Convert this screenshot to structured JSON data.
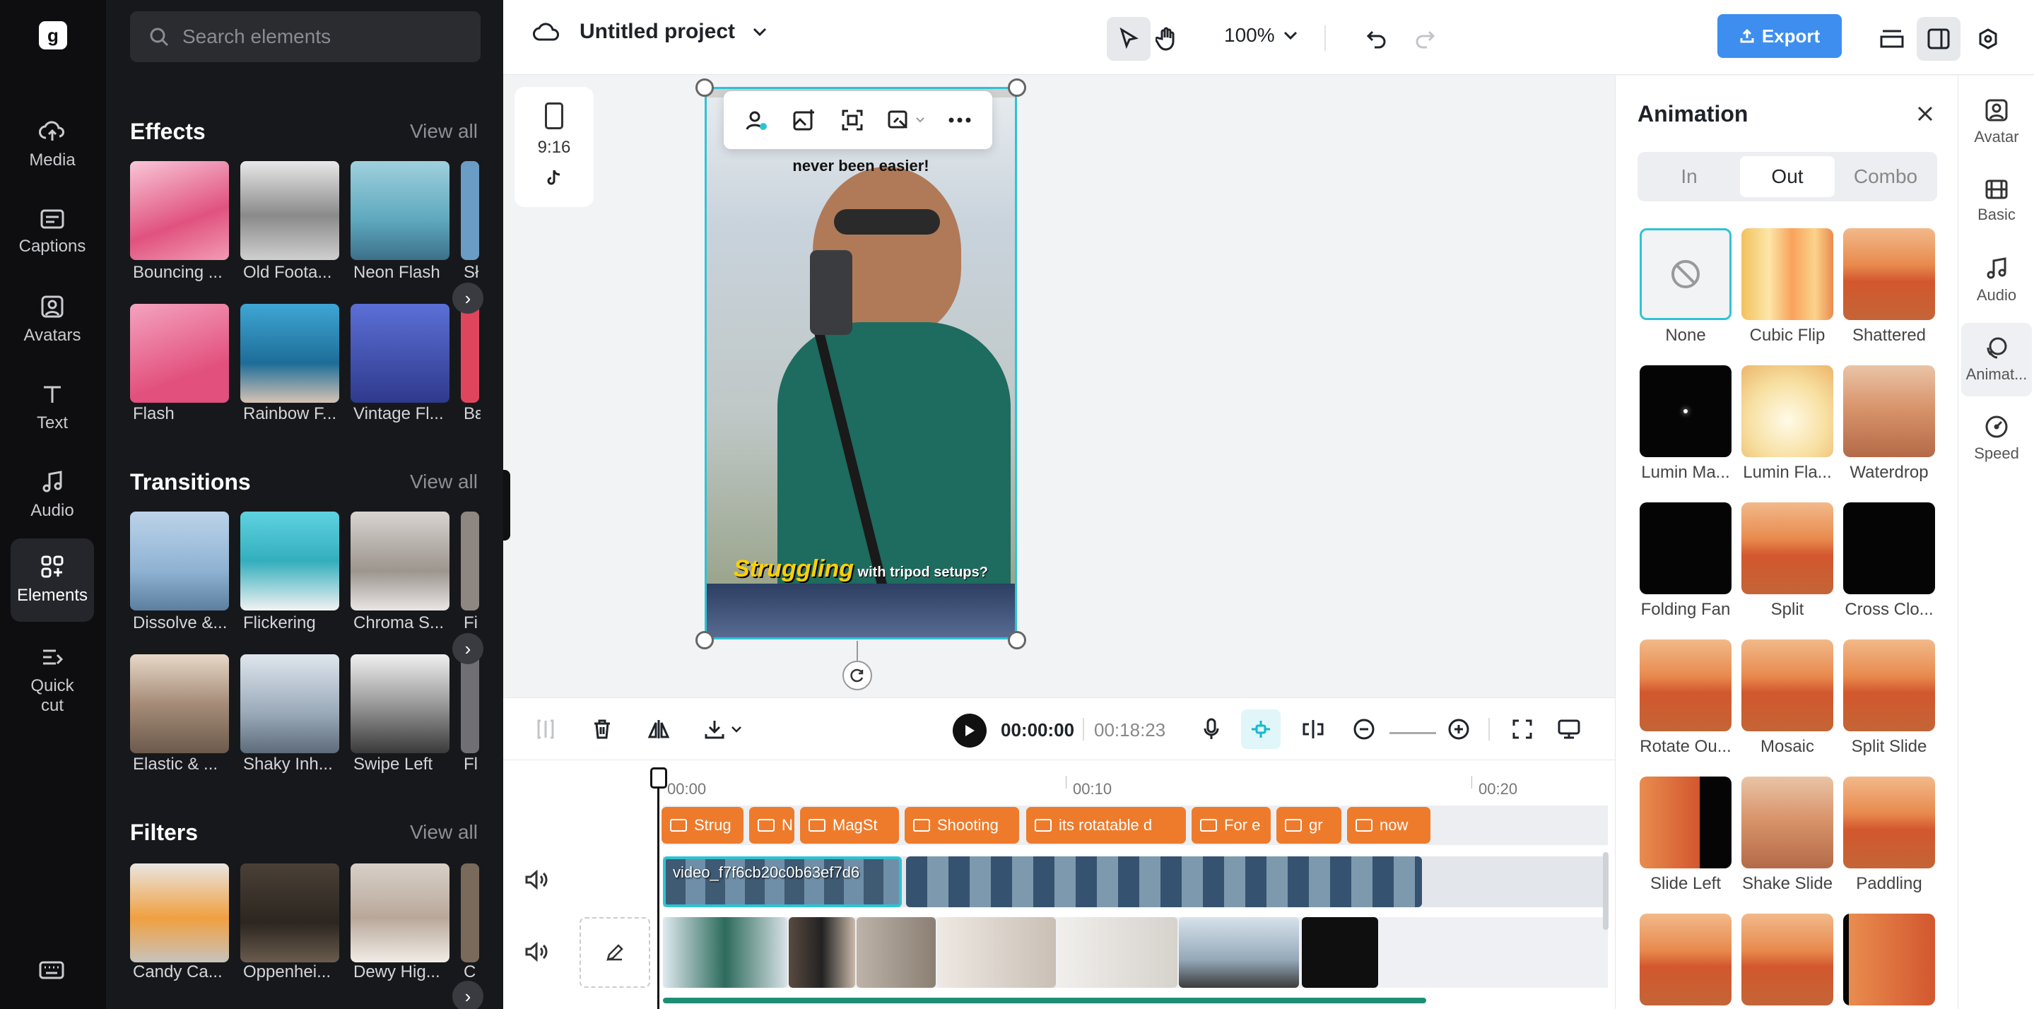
{
  "colors": {
    "accent": "#3d8eef",
    "selection": "#2ec3d4",
    "caption_chip": "#ee7b2b",
    "rail_bg": "#0e0e10",
    "panel_bg": "#17181b"
  },
  "rail": {
    "items": [
      {
        "label": "Media",
        "icon": "cloud-upload-icon"
      },
      {
        "label": "Captions",
        "icon": "captions-icon"
      },
      {
        "label": "Avatars",
        "icon": "avatar-icon"
      },
      {
        "label": "Text",
        "icon": "text-icon"
      },
      {
        "label": "Audio",
        "icon": "music-note-icon"
      },
      {
        "label": "Elements",
        "icon": "elements-icon",
        "active": true
      },
      {
        "label": "Quick\ncut",
        "icon": "quick-cut-icon"
      }
    ]
  },
  "panel": {
    "search_placeholder": "Search elements",
    "effects": {
      "title": "Effects",
      "view_all": "View all",
      "items": [
        "Bouncing ...",
        "Old Foota...",
        "Neon Flash",
        "Sł",
        "Flash",
        "Rainbow F...",
        "Vintage Fl...",
        "Bε"
      ]
    },
    "transitions": {
      "title": "Transitions",
      "view_all": "View all",
      "items": [
        "Dissolve &...",
        "Flickering",
        "Chroma S...",
        "Fi",
        "Elastic & ...",
        "Shaky Inh...",
        "Swipe Left",
        "Fl"
      ]
    },
    "filters": {
      "title": "Filters",
      "view_all": "View all",
      "items": [
        "Candy Ca...",
        "Oppenhei...",
        "Dewy Hig...",
        "C"
      ]
    }
  },
  "topbar": {
    "project_title": "Untitled project",
    "zoom": "100%",
    "export_label": "Export"
  },
  "canvas": {
    "ratio_label": "9:16",
    "caption_top": "never been easier!",
    "caption_highlight": "Struggling",
    "caption_rest": " with tripod setups?"
  },
  "playbar": {
    "current_time": "00:00:00",
    "duration": "00:18:23"
  },
  "timeline": {
    "ruler": [
      "00:00",
      "00:10",
      "00:20"
    ],
    "captions": [
      "Strug",
      "N",
      "MagSt",
      "Shooting",
      "its rotatable d",
      "For e",
      "gr",
      "now"
    ],
    "video_clip_name": "video_f7f6cb20c0b63ef7d6"
  },
  "animation": {
    "title": "Animation",
    "tabs": [
      "In",
      "Out",
      "Combo"
    ],
    "active_tab": "Out",
    "selected": "None",
    "items": [
      "None",
      "Cubic Flip",
      "Shattered",
      "Lumin Ma...",
      "Lumin Fla...",
      "Waterdrop",
      "Folding Fan",
      "Split",
      "Cross Clo...",
      "Rotate Ou...",
      "Mosaic",
      "Split Slide",
      "Slide Left",
      "Shake Slide",
      "Paddling",
      "",
      "",
      ""
    ]
  },
  "right_rail": {
    "items": [
      {
        "label": "Avatar",
        "icon": "avatar-icon"
      },
      {
        "label": "Basic",
        "icon": "film-icon"
      },
      {
        "label": "Audio",
        "icon": "music-note-icon"
      },
      {
        "label": "Animat...",
        "icon": "animation-icon",
        "active": true
      },
      {
        "label": "Speed",
        "icon": "speed-icon"
      }
    ]
  }
}
